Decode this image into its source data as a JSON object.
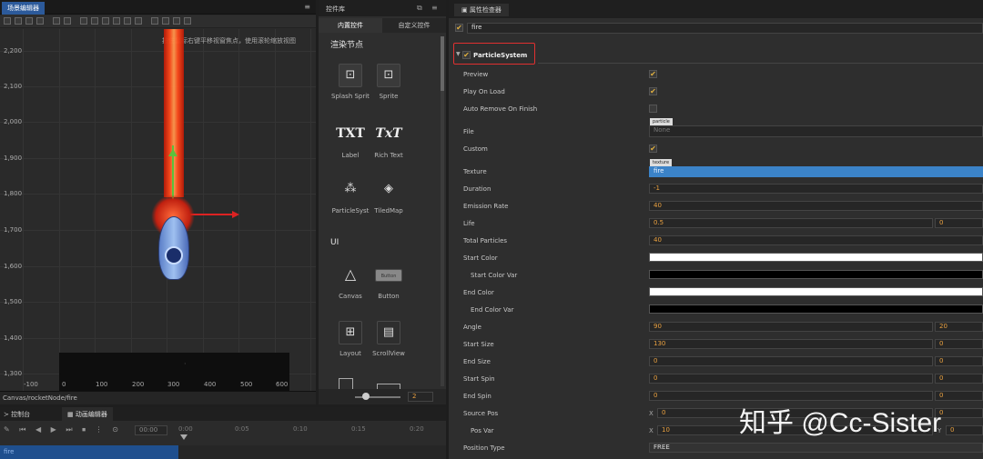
{
  "scene": {
    "tab_title": "场景编辑器",
    "hint": "按住鼠标右键平移视窗焦点，使用滚轮缩放视图",
    "y_labels": [
      "2,200",
      "2,100",
      "2,000",
      "1,900",
      "1,800",
      "1,700",
      "1,600",
      "1,500",
      "1,400",
      "1,300"
    ],
    "x_labels": [
      "-100",
      "0",
      "100",
      "200",
      "300",
      "400",
      "500",
      "600"
    ],
    "path": "Canvas/rocketNode/fire"
  },
  "library": {
    "title": "控件库",
    "tabs": [
      "内置控件",
      "自定义控件"
    ],
    "sections": [
      "渲染节点",
      "UI"
    ],
    "items": [
      "Splash Sprit",
      "Sprite",
      "Label",
      "Rich Text",
      "ParticleSyst",
      "TiledMap",
      "Canvas",
      "Button",
      "Layout",
      "ScrollView"
    ],
    "icon_glyphs": [
      "TXT",
      "TxT"
    ],
    "button_icon_text": "Button",
    "zoom_value": "2"
  },
  "bottom": {
    "tab_console": "控制台",
    "tab_anim": "动画编辑器",
    "time_value": "00:00",
    "ticks": [
      "0:00",
      "0:05",
      "0:10",
      "0:15",
      "0:20"
    ],
    "bottom_text": "fire"
  },
  "inspector": {
    "title": "属性检查器",
    "node_name": "fire",
    "component": "ParticleSystem",
    "props": {
      "preview": "Preview",
      "play_on_load": "Play On Load",
      "auto_remove": "Auto Remove On Finish",
      "file": "File",
      "file_tag": "particle",
      "file_value": "None",
      "custom": "Custom",
      "texture": "Texture",
      "texture_tag": "texture",
      "texture_value": "fire",
      "duration": "Duration",
      "duration_value": "-1",
      "emission_rate": "Emission Rate",
      "emission_value": "40",
      "life": "Life",
      "life_value": "0.5",
      "life_var": "0",
      "total_particles": "Total Particles",
      "total_value": "40",
      "start_color": "Start Color",
      "start_color_var": "Start Color Var",
      "end_color": "End Color",
      "end_color_var": "End Color Var",
      "angle": "Angle",
      "angle_value": "90",
      "angle_var": "20",
      "start_size": "Start Size",
      "start_size_value": "130",
      "start_size_var": "0",
      "end_size": "End Size",
      "end_size_value": "0",
      "end_size_var": "0",
      "start_spin": "Start Spin",
      "start_spin_value": "0",
      "start_spin_var": "0",
      "end_spin": "End Spin",
      "end_spin_value": "0",
      "end_spin_var": "0",
      "source_pos": "Source Pos",
      "source_x_label": "X",
      "source_x": "0",
      "source_y": "0",
      "pos_var": "Pos Var",
      "pos_var_x_label": "X",
      "pos_var_x": "10",
      "pos_var_y_label": "Y",
      "pos_var_y": "0",
      "position_type": "Position Type",
      "position_type_value": "FREE"
    }
  },
  "watermark": "知乎 @Cc-Sister",
  "colors": {
    "accent": "#2c5a9b",
    "highlight_box": "#e03030",
    "orange_value": "#e8a040",
    "flame": "#ff4a1a"
  }
}
